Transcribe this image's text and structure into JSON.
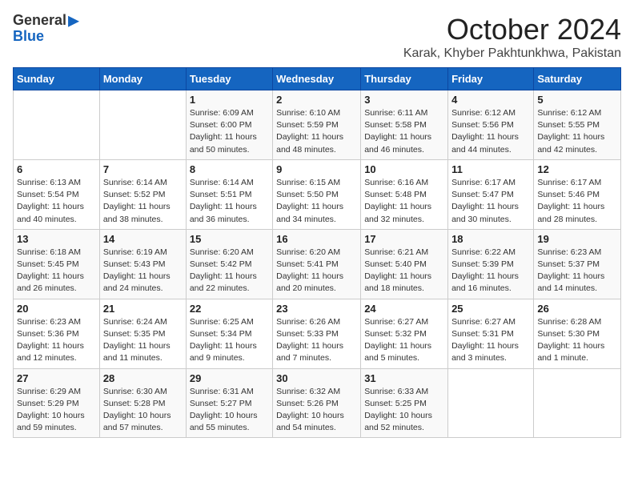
{
  "logo": {
    "general": "General",
    "blue": "Blue"
  },
  "header": {
    "month": "October 2024",
    "location": "Karak, Khyber Pakhtunkhwa, Pakistan"
  },
  "weekdays": [
    "Sunday",
    "Monday",
    "Tuesday",
    "Wednesday",
    "Thursday",
    "Friday",
    "Saturday"
  ],
  "weeks": [
    [
      {
        "day": "",
        "info": ""
      },
      {
        "day": "",
        "info": ""
      },
      {
        "day": "1",
        "info": "Sunrise: 6:09 AM\nSunset: 6:00 PM\nDaylight: 11 hours and 50 minutes."
      },
      {
        "day": "2",
        "info": "Sunrise: 6:10 AM\nSunset: 5:59 PM\nDaylight: 11 hours and 48 minutes."
      },
      {
        "day": "3",
        "info": "Sunrise: 6:11 AM\nSunset: 5:58 PM\nDaylight: 11 hours and 46 minutes."
      },
      {
        "day": "4",
        "info": "Sunrise: 6:12 AM\nSunset: 5:56 PM\nDaylight: 11 hours and 44 minutes."
      },
      {
        "day": "5",
        "info": "Sunrise: 6:12 AM\nSunset: 5:55 PM\nDaylight: 11 hours and 42 minutes."
      }
    ],
    [
      {
        "day": "6",
        "info": "Sunrise: 6:13 AM\nSunset: 5:54 PM\nDaylight: 11 hours and 40 minutes."
      },
      {
        "day": "7",
        "info": "Sunrise: 6:14 AM\nSunset: 5:52 PM\nDaylight: 11 hours and 38 minutes."
      },
      {
        "day": "8",
        "info": "Sunrise: 6:14 AM\nSunset: 5:51 PM\nDaylight: 11 hours and 36 minutes."
      },
      {
        "day": "9",
        "info": "Sunrise: 6:15 AM\nSunset: 5:50 PM\nDaylight: 11 hours and 34 minutes."
      },
      {
        "day": "10",
        "info": "Sunrise: 6:16 AM\nSunset: 5:48 PM\nDaylight: 11 hours and 32 minutes."
      },
      {
        "day": "11",
        "info": "Sunrise: 6:17 AM\nSunset: 5:47 PM\nDaylight: 11 hours and 30 minutes."
      },
      {
        "day": "12",
        "info": "Sunrise: 6:17 AM\nSunset: 5:46 PM\nDaylight: 11 hours and 28 minutes."
      }
    ],
    [
      {
        "day": "13",
        "info": "Sunrise: 6:18 AM\nSunset: 5:45 PM\nDaylight: 11 hours and 26 minutes."
      },
      {
        "day": "14",
        "info": "Sunrise: 6:19 AM\nSunset: 5:43 PM\nDaylight: 11 hours and 24 minutes."
      },
      {
        "day": "15",
        "info": "Sunrise: 6:20 AM\nSunset: 5:42 PM\nDaylight: 11 hours and 22 minutes."
      },
      {
        "day": "16",
        "info": "Sunrise: 6:20 AM\nSunset: 5:41 PM\nDaylight: 11 hours and 20 minutes."
      },
      {
        "day": "17",
        "info": "Sunrise: 6:21 AM\nSunset: 5:40 PM\nDaylight: 11 hours and 18 minutes."
      },
      {
        "day": "18",
        "info": "Sunrise: 6:22 AM\nSunset: 5:39 PM\nDaylight: 11 hours and 16 minutes."
      },
      {
        "day": "19",
        "info": "Sunrise: 6:23 AM\nSunset: 5:37 PM\nDaylight: 11 hours and 14 minutes."
      }
    ],
    [
      {
        "day": "20",
        "info": "Sunrise: 6:23 AM\nSunset: 5:36 PM\nDaylight: 11 hours and 12 minutes."
      },
      {
        "day": "21",
        "info": "Sunrise: 6:24 AM\nSunset: 5:35 PM\nDaylight: 11 hours and 11 minutes."
      },
      {
        "day": "22",
        "info": "Sunrise: 6:25 AM\nSunset: 5:34 PM\nDaylight: 11 hours and 9 minutes."
      },
      {
        "day": "23",
        "info": "Sunrise: 6:26 AM\nSunset: 5:33 PM\nDaylight: 11 hours and 7 minutes."
      },
      {
        "day": "24",
        "info": "Sunrise: 6:27 AM\nSunset: 5:32 PM\nDaylight: 11 hours and 5 minutes."
      },
      {
        "day": "25",
        "info": "Sunrise: 6:27 AM\nSunset: 5:31 PM\nDaylight: 11 hours and 3 minutes."
      },
      {
        "day": "26",
        "info": "Sunrise: 6:28 AM\nSunset: 5:30 PM\nDaylight: 11 hours and 1 minute."
      }
    ],
    [
      {
        "day": "27",
        "info": "Sunrise: 6:29 AM\nSunset: 5:29 PM\nDaylight: 10 hours and 59 minutes."
      },
      {
        "day": "28",
        "info": "Sunrise: 6:30 AM\nSunset: 5:28 PM\nDaylight: 10 hours and 57 minutes."
      },
      {
        "day": "29",
        "info": "Sunrise: 6:31 AM\nSunset: 5:27 PM\nDaylight: 10 hours and 55 minutes."
      },
      {
        "day": "30",
        "info": "Sunrise: 6:32 AM\nSunset: 5:26 PM\nDaylight: 10 hours and 54 minutes."
      },
      {
        "day": "31",
        "info": "Sunrise: 6:33 AM\nSunset: 5:25 PM\nDaylight: 10 hours and 52 minutes."
      },
      {
        "day": "",
        "info": ""
      },
      {
        "day": "",
        "info": ""
      }
    ]
  ]
}
